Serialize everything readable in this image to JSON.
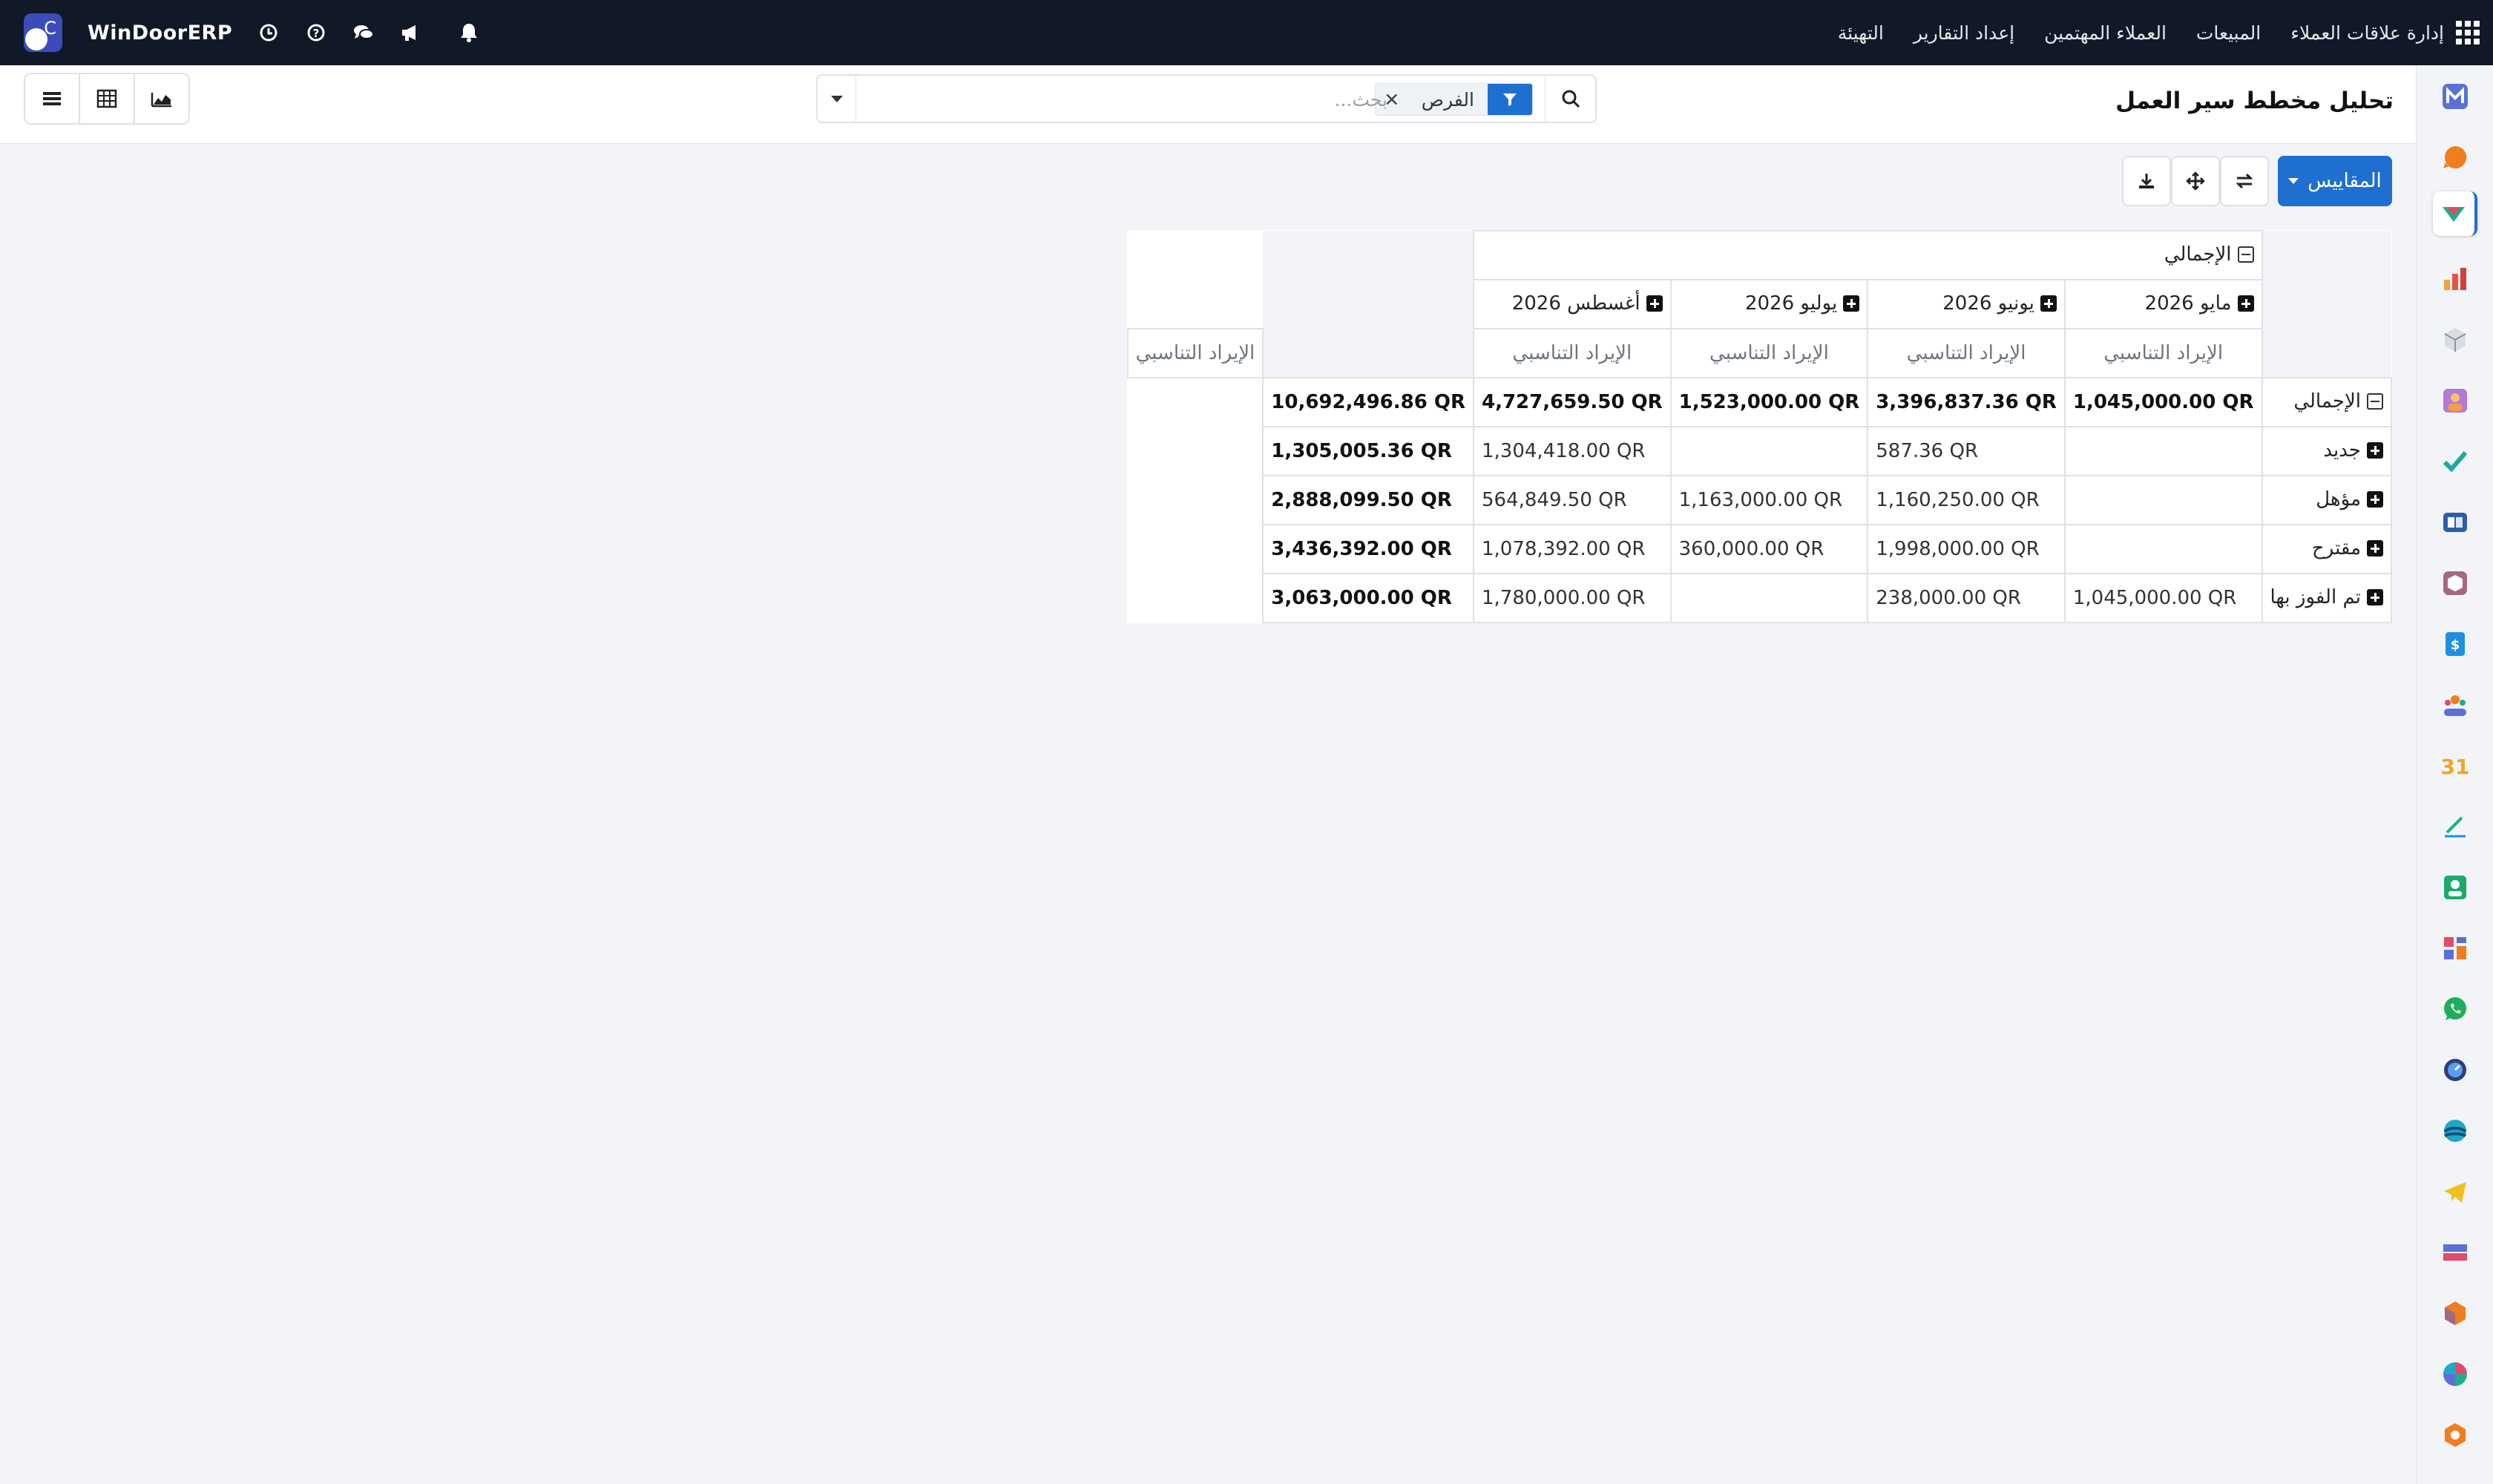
{
  "navbar": {
    "brand": "WinDoorERP",
    "menu": [
      "إدارة علاقات العملاء",
      "المبيعات",
      "العملاء المهتمين",
      "إعداد التقارير",
      "التهيئة"
    ]
  },
  "control": {
    "title": "تحليل مخطط سير العمل",
    "facet_value": "الفرص",
    "search_placeholder": "بحث..."
  },
  "toolbar": {
    "measures_label": "المقاييس"
  },
  "pivot": {
    "total_label": "الإجمالي",
    "col_headers": [
      "مايو 2026",
      "يونيو 2026",
      "يوليو 2026",
      "أغسطس 2026"
    ],
    "measure_label": "الإيراد التناسبي",
    "total_row": [
      "1,045,000.00 QR",
      "3,396,837.36 QR",
      "1,523,000.00 QR",
      "4,727,659.50 QR",
      "10,692,496.86 QR"
    ],
    "rows": [
      {
        "label": "جديد",
        "values": [
          "",
          "587.36 QR",
          "",
          "1,304,418.00 QR",
          "1,305,005.36 QR"
        ]
      },
      {
        "label": "مؤهل",
        "values": [
          "",
          "1,160,250.00 QR",
          "1,163,000.00 QR",
          "564,849.50 QR",
          "2,888,099.50 QR"
        ]
      },
      {
        "label": "مقترح",
        "values": [
          "",
          "1,998,000.00 QR",
          "360,000.00 QR",
          "1,078,392.00 QR",
          "3,436,392.00 QR"
        ]
      },
      {
        "label": "تم الفوز بها",
        "values": [
          "1,045,000.00 QR",
          "238,000.00 QR",
          "",
          "1,780,000.00 QR",
          "3,063,000.00 QR"
        ]
      }
    ]
  },
  "sidebar": {
    "apps": [
      "mailing-app",
      "discuss-app",
      "crm-app",
      "reporting-app",
      "inventory-app",
      "employees-app",
      "todo-app",
      "knowledge-app",
      "products-app",
      "invoicing-app",
      "contacts-app",
      "calendar-app",
      "sign-app",
      "members-app",
      "dashboards-app",
      "whatsapp-app",
      "timesheets-app",
      "live-chat-app",
      "telegram-app",
      "website-app",
      "modules-app",
      "surveys-app",
      "settings-app"
    ],
    "active_index": 2
  }
}
